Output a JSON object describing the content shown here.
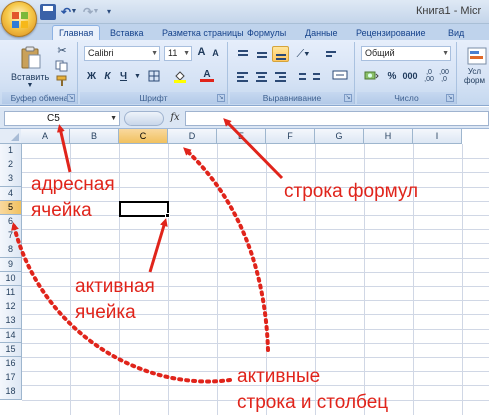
{
  "window": {
    "title": "Книга1 - Micr"
  },
  "ribbon": {
    "tabs": [
      {
        "label": "Главная",
        "active": true
      },
      {
        "label": "Вставка",
        "active": false
      },
      {
        "label": "Разметка страницы",
        "active": false
      },
      {
        "label": "Формулы",
        "active": false
      },
      {
        "label": "Данные",
        "active": false
      },
      {
        "label": "Рецензирование",
        "active": false
      },
      {
        "label": "Вид",
        "active": false
      }
    ],
    "clipboard": {
      "paste_label": "Вставить",
      "group_label": "Буфер обмена"
    },
    "font": {
      "font_name": "Calibri",
      "font_size": "11",
      "bold": "Ж",
      "italic": "К",
      "underline": "Ч",
      "grow": "A",
      "shrink": "A",
      "font_color_glyph": "A",
      "group_label": "Шрифт"
    },
    "alignment": {
      "group_label": "Выравнивание"
    },
    "number": {
      "format": "Общий",
      "percent": "%",
      "thousands": "000",
      "group_label": "Число"
    },
    "styles": {
      "partial_label_1": "Усл",
      "partial_label_2": "форм"
    }
  },
  "formula_bar": {
    "cell_ref": "C5",
    "fx": "fx",
    "value": ""
  },
  "sheet": {
    "columns": [
      "A",
      "B",
      "C",
      "D",
      "E",
      "F",
      "G",
      "H",
      "I"
    ],
    "rows": [
      "1",
      "2",
      "3",
      "4",
      "5",
      "6",
      "7",
      "8",
      "9",
      "10",
      "11",
      "12",
      "13",
      "14",
      "15",
      "16",
      "17",
      "18"
    ],
    "active_column": "C",
    "active_row": "5"
  },
  "annotations": {
    "address_cell": [
      "адресная",
      "ячейка"
    ],
    "formula_bar": "строка формул",
    "active_cell": [
      "активная",
      "ячейка"
    ],
    "active_row_col": [
      "активные",
      "строка и столбец"
    ]
  },
  "colors": {
    "annotation": "#e0241b",
    "active_header": "#f1c15f",
    "ribbon_bg": "#d6e3f5"
  }
}
